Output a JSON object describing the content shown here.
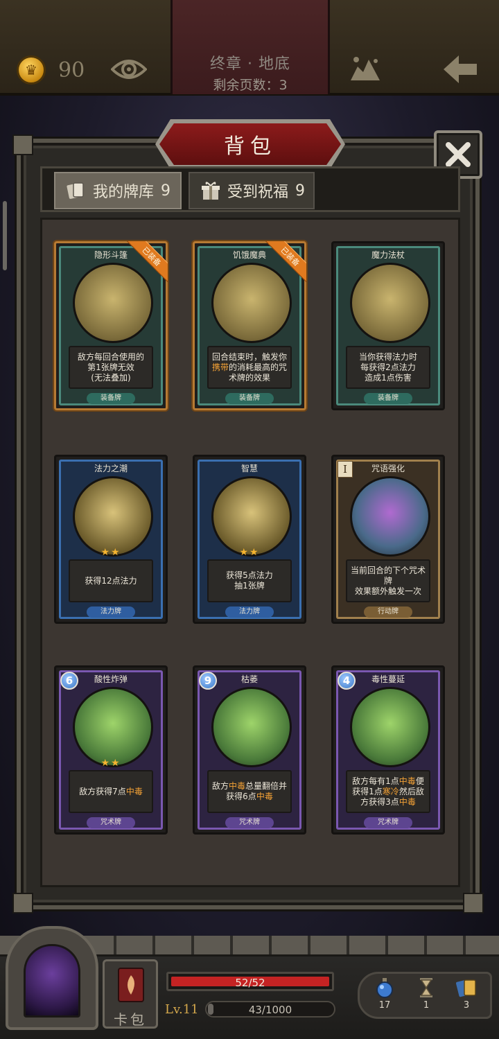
{
  "header": {
    "gold": "90",
    "chapter_title": "终章 · 地底",
    "pages_left": "剩余页数：3",
    "icons": [
      "crown-coin-icon",
      "eye-icon",
      "map-icon",
      "back-arrow-icon"
    ]
  },
  "panel": {
    "title": "背包",
    "close_icon": "close-icon",
    "tabs": [
      {
        "label": "我的牌库",
        "count": "9",
        "icon": "cards-icon"
      },
      {
        "label": "受到祝福",
        "count": "9",
        "icon": "gift-icon"
      }
    ]
  },
  "cards": [
    {
      "name": "隐形斗篷",
      "category": "equip",
      "type": "装备牌",
      "equipped_badge": "已装备",
      "desc": [
        "敌方每回合使用的",
        "第1张牌无效",
        "(无法叠加)"
      ]
    },
    {
      "name": "饥饿魔典",
      "category": "equip",
      "type": "装备牌",
      "equipped_badge": "已装备",
      "desc_parts": [
        {
          "t": "回合结束时，触发你"
        },
        {
          "t": "携带",
          "hl": true
        },
        {
          "t": "的消耗最高的"
        },
        {
          "t": "咒术牌的效果"
        }
      ]
    },
    {
      "name": "魔力法杖",
      "category": "equip",
      "type": "装备牌",
      "desc": [
        "当你获得法力时",
        "每获得2点法力",
        "造成1点伤害"
      ]
    },
    {
      "name": "法力之潮",
      "category": "mana",
      "type": "法力牌",
      "stars": "★★",
      "desc": [
        "获得12点法力"
      ]
    },
    {
      "name": "智慧",
      "category": "mana",
      "type": "法力牌",
      "stars": "★★",
      "desc": [
        "获得5点法力",
        "抽1张牌"
      ]
    },
    {
      "name": "咒语强化",
      "category": "action",
      "type": "行动牌",
      "roman": "I",
      "desc": [
        "当前回合的下个咒术牌",
        "效果额外触发一次"
      ]
    },
    {
      "name": "酸性炸弹",
      "category": "spell",
      "type": "咒术牌",
      "cost": "6",
      "stars": "★★",
      "desc_parts": [
        {
          "t": "敌方获得7点"
        },
        {
          "t": "中毒",
          "hl": true
        }
      ]
    },
    {
      "name": "枯萎",
      "category": "spell",
      "type": "咒术牌",
      "cost": "9",
      "desc_parts": [
        {
          "t": "敌方"
        },
        {
          "t": "中毒",
          "hl": true
        },
        {
          "t": "总量翻倍并"
        },
        {
          "t": "获得6点"
        },
        {
          "t": "中毒",
          "hl": true
        }
      ]
    },
    {
      "name": "毒性蔓延",
      "category": "spell",
      "type": "咒术牌",
      "cost": "4",
      "desc_parts": [
        {
          "t": "敌方每有1点"
        },
        {
          "t": "中毒",
          "hl": true
        },
        {
          "t": "便获得1点"
        },
        {
          "t": "寒冷",
          "hl": true
        },
        {
          "t": "然后敌方获得3点"
        },
        {
          "t": "中毒",
          "hl": true
        }
      ]
    }
  ],
  "hud": {
    "hp": "52/52",
    "hp_ratio": 1.0,
    "level": "Lv.11",
    "xp": "43/1000",
    "xp_ratio": 0.043,
    "deck_label": "卡包",
    "inventory": [
      {
        "icon": "potion-icon",
        "count": "17"
      },
      {
        "icon": "hourglass-icon",
        "count": "1"
      },
      {
        "icon": "cards-stack-icon",
        "count": "3"
      }
    ]
  },
  "colors": {
    "accent_red": "#c42323",
    "highlight": "#f4a236",
    "gold": "#d4a84c"
  }
}
